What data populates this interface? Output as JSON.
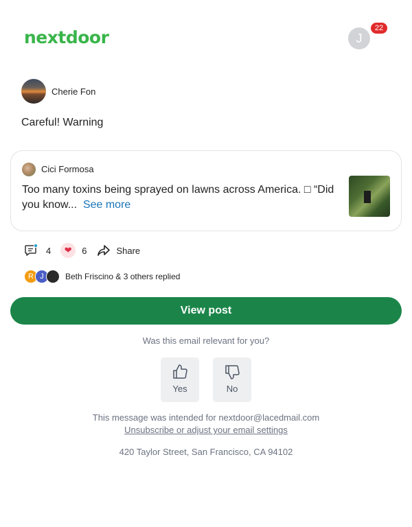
{
  "header": {
    "logo_text": "nextdoor",
    "user_initial": "J",
    "notification_count": "22"
  },
  "post": {
    "author": "Cherie Fon",
    "text": "Careful! Warning"
  },
  "shared": {
    "author": "Cici Formosa",
    "text": "Too many toxins being sprayed on lawns across America. □ “Did you know...",
    "see_more": "See more"
  },
  "actions": {
    "comments": "4",
    "reactions": "6",
    "share_label": "Share"
  },
  "replies": {
    "avatars": [
      "R",
      "J",
      ""
    ],
    "text": "Beth Friscino & 3 others replied"
  },
  "cta": {
    "view_post": "View post"
  },
  "feedback": {
    "question": "Was this email relevant for you?",
    "yes": "Yes",
    "no": "No"
  },
  "footer": {
    "intended": "This message was intended for nextdoor@lacedmail.com",
    "unsubscribe": "Unsubscribe or adjust your email settings",
    "address": "420 Taylor Street, San Francisco, CA 94102"
  },
  "colors": {
    "brand_green": "#39b54a",
    "button_green": "#1b8549",
    "link_blue": "#1a75b8",
    "badge_red": "#e12b2b"
  }
}
